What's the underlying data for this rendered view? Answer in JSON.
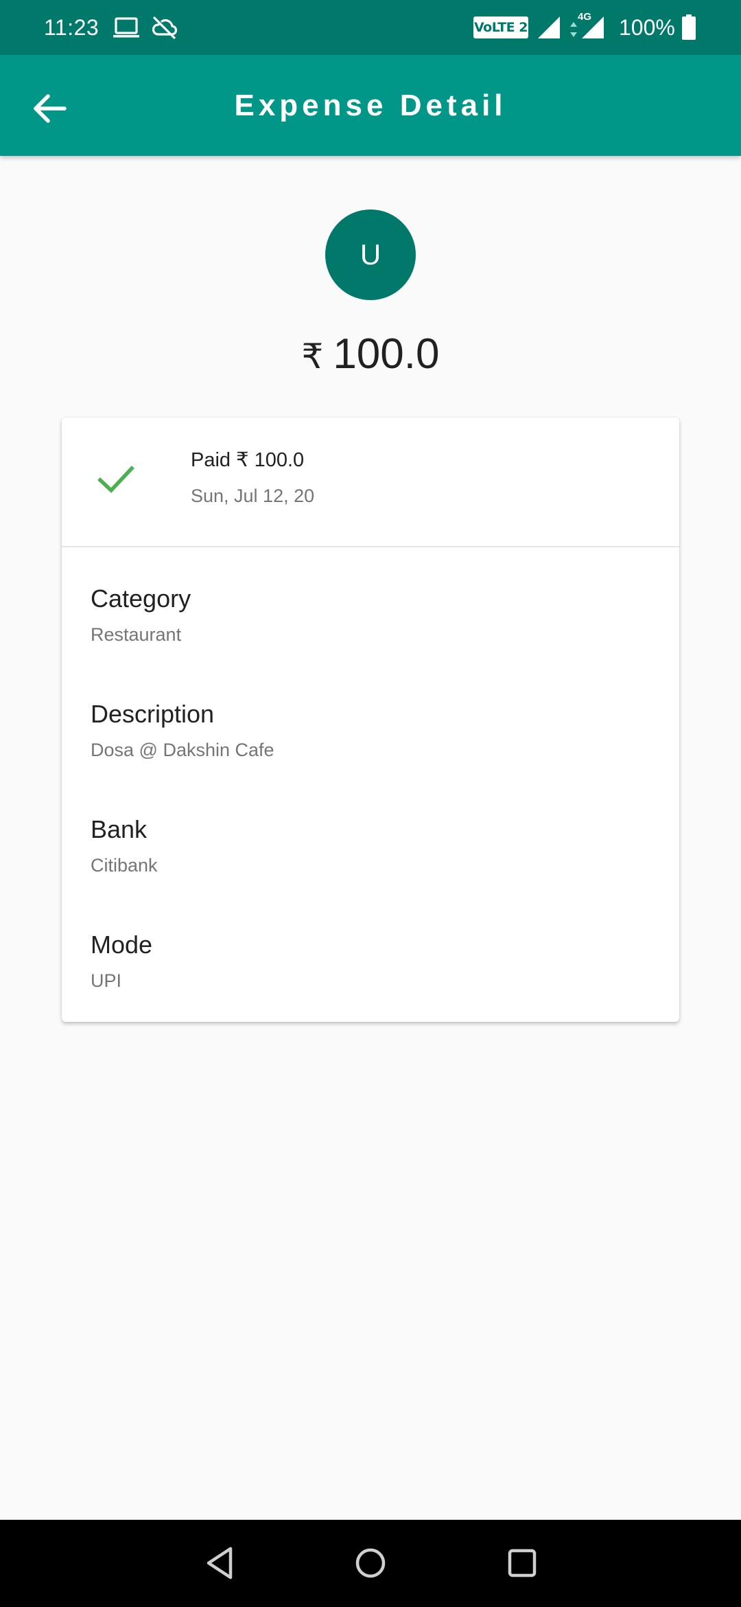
{
  "status_bar": {
    "time": "11:23",
    "network_badge": "VoLTE 2",
    "network_type": "4G",
    "battery": "100%",
    "icons": [
      "laptop-icon",
      "cloud-off-icon",
      "signal-icon",
      "battery-icon"
    ]
  },
  "app_bar": {
    "title": "Expense Detail",
    "back_icon": "arrow-back-icon"
  },
  "summary": {
    "avatar_initial": "U",
    "currency_symbol": "₹",
    "amount": "100.0"
  },
  "card": {
    "status_icon": "check-icon",
    "status_text": "Paid ₹ 100.0",
    "date": "Sun, Jul 12, 20",
    "fields": [
      {
        "label": "Category",
        "value": "Restaurant"
      },
      {
        "label": "Description",
        "value": "Dosa @ Dakshin Cafe"
      },
      {
        "label": "Bank",
        "value": "Citibank"
      },
      {
        "label": "Mode",
        "value": "UPI"
      }
    ]
  },
  "nav_bar": {
    "buttons": [
      "back-triangle-icon",
      "home-circle-icon",
      "recents-square-icon"
    ]
  },
  "colors": {
    "status_bar": "#00796b",
    "app_bar": "#009688",
    "avatar": "#00796b",
    "check": "#4caf50",
    "background": "#fafafa"
  }
}
